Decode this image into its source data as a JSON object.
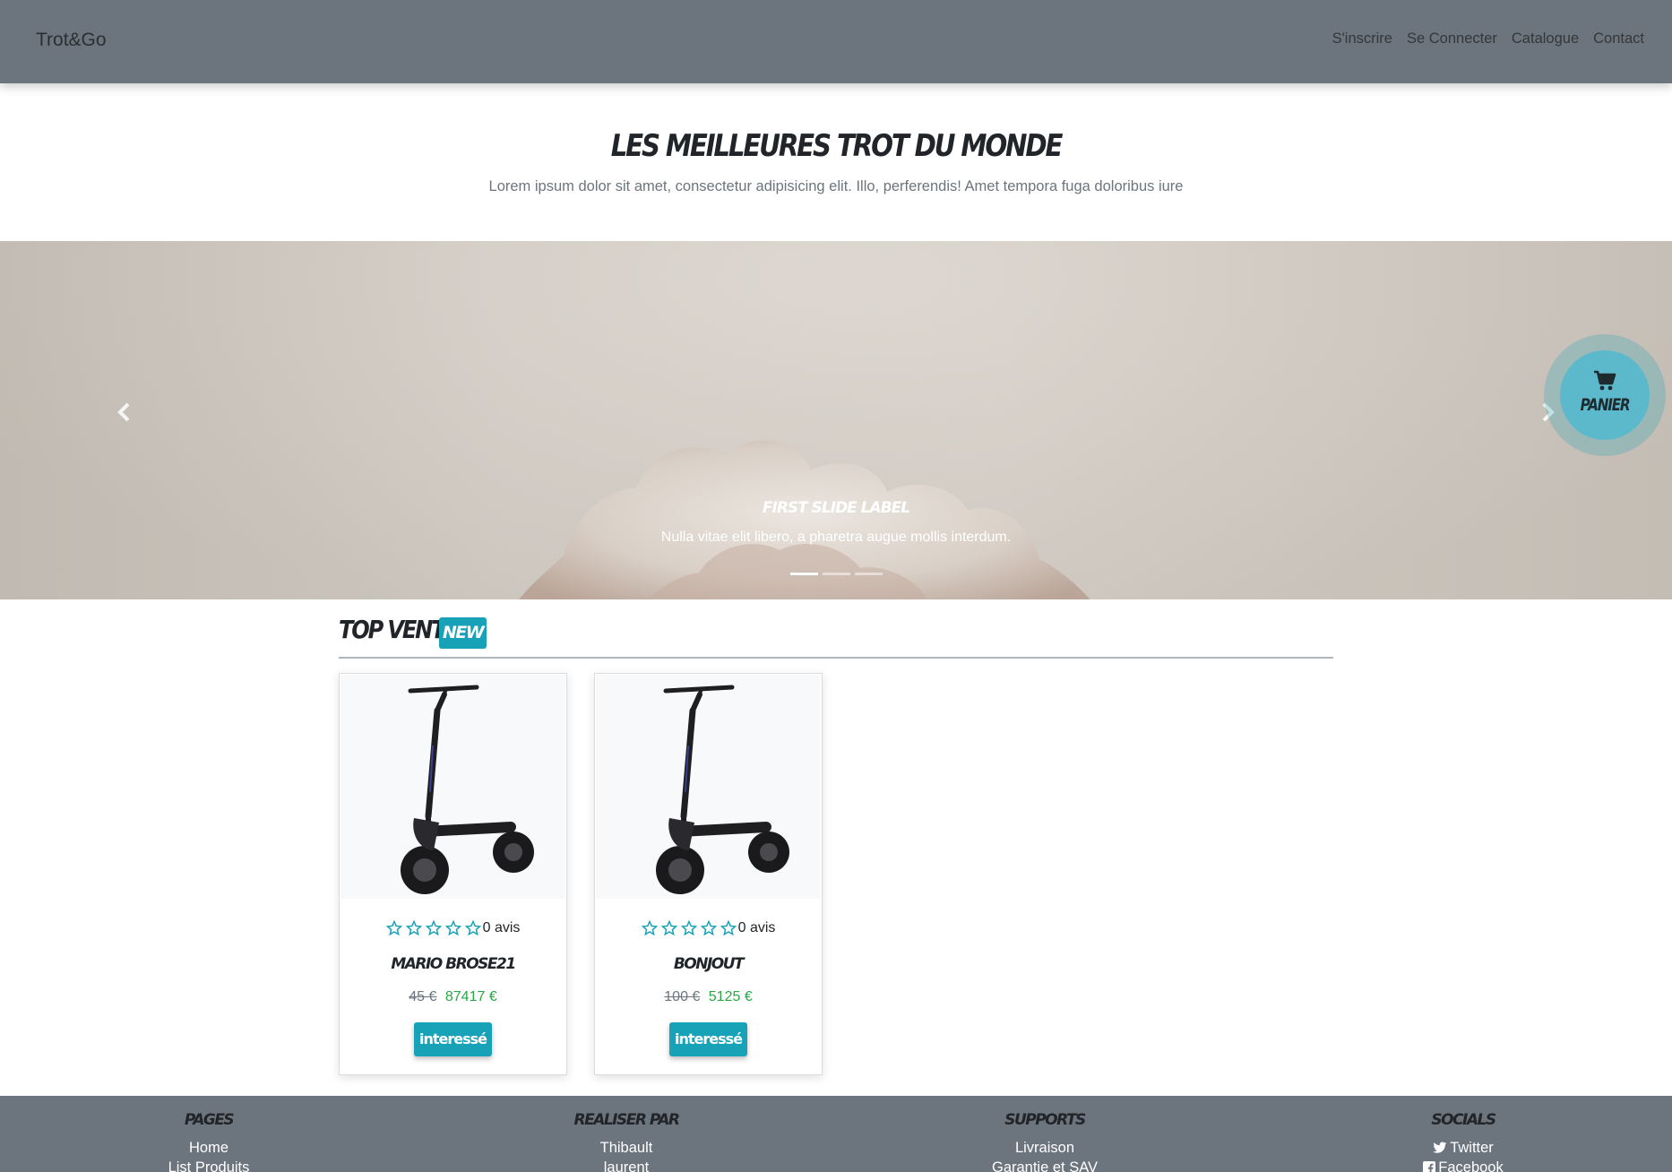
{
  "navbar": {
    "brand": "Trot&Go",
    "links": [
      "S'inscrire",
      "Se Connecter",
      "Catalogue",
      "Contact"
    ]
  },
  "hero": {
    "title": "Les meilleures trot du monde",
    "subtitle": "Lorem ipsum dolor sit amet, consectetur adipisicing elit. Illo, perferendis! Amet tempora fuga doloribus iure"
  },
  "carousel": {
    "caption_title": "First slide label",
    "caption_text": "Nulla vitae elit libero, a pharetra augue mollis interdum.",
    "slide_count": 3,
    "active_index": 0,
    "prev_icon": "chevron-left-icon",
    "next_icon": "chevron-right-icon"
  },
  "panier": {
    "label": "Panier",
    "icon": "cart-icon"
  },
  "top_vente": {
    "title": "Top Vente",
    "badge": "New"
  },
  "products": [
    {
      "name": "Mario Brose21",
      "rating": 0,
      "reviews": "0 avis",
      "old_price": "45 €",
      "price": "87417 €",
      "button": "interessé"
    },
    {
      "name": "Bonjout",
      "rating": 0,
      "reviews": "0 avis",
      "old_price": "100 €",
      "price": "5125 €",
      "button": "interessé"
    }
  ],
  "footer": {
    "columns": [
      {
        "heading": "Pages",
        "links": [
          "Home",
          "List Produits"
        ]
      },
      {
        "heading": "Realiser par",
        "links": [
          "Thibault",
          "laurent"
        ]
      },
      {
        "heading": "Supports",
        "links": [
          "Livraison",
          "Garantie et SAV"
        ]
      },
      {
        "heading": "Socials",
        "links": [
          "Twitter",
          "Facebook"
        ]
      }
    ]
  },
  "colors": {
    "navbar_bg": "#6c757d",
    "accent": "#17a2b8",
    "price_green": "#28a745",
    "old_price_gray": "#6c757d"
  }
}
